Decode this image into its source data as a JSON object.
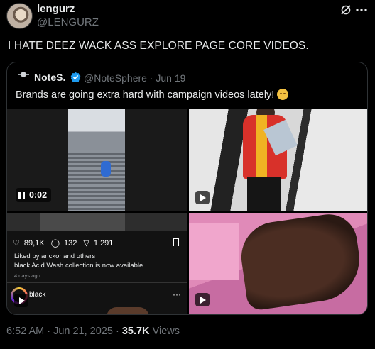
{
  "tweet": {
    "display_name": "lengurz",
    "handle": "@LENGURZ",
    "text": "I HATE DEEZ WACK ASS EXPLORE PAGE CORE VIDEOS.",
    "timestamp": "6:52 AM · Jun 21, 2025 ·",
    "views_count": "35.7K",
    "views_label": "Views"
  },
  "quote": {
    "display_name": "NoteS.",
    "handle_date": "@NoteSphere · Jun 19",
    "text": "Brands are going extra hard with campaign videos lately!",
    "media": [
      {
        "kind": "video",
        "time": "0:02",
        "state": "paused"
      },
      {
        "kind": "video"
      },
      {
        "kind": "video",
        "ig_post": {
          "likes": "89,1K",
          "comments": "132",
          "shares": "1.291",
          "liked_by": "Liked by anckor and others",
          "caption": "black Acid Wash collection is now available.",
          "date": "4 days ago",
          "username": "black",
          "more": "···"
        }
      },
      {
        "kind": "video"
      }
    ]
  },
  "colors": {
    "background": "#000000",
    "text": "#e7e9ea",
    "muted": "#71767b",
    "border": "#2f3336",
    "verified": "#1d9bf0"
  }
}
